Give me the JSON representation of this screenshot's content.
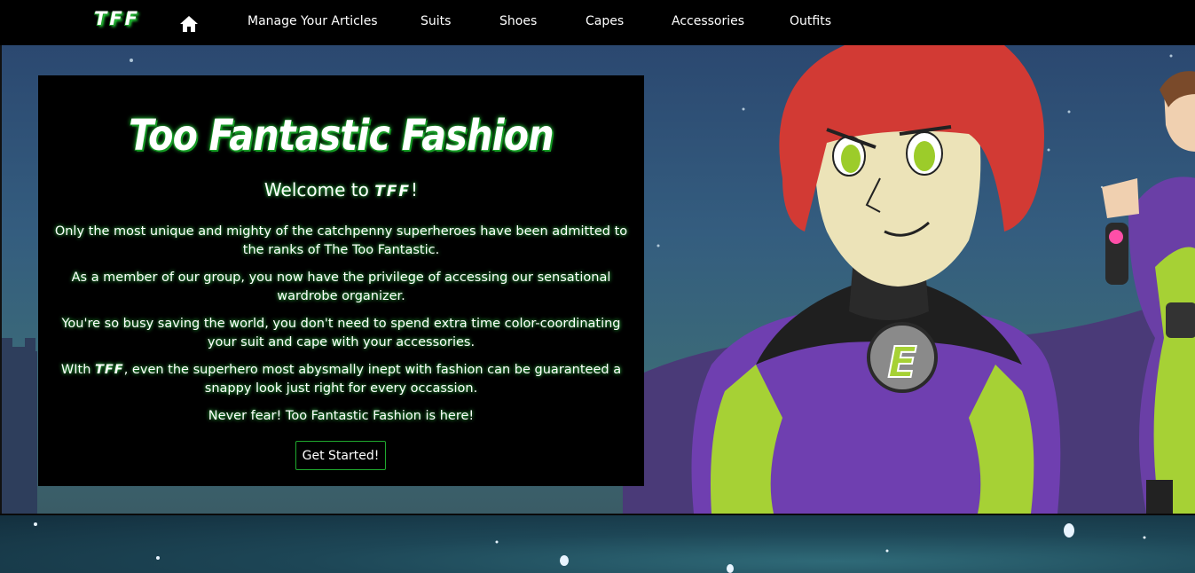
{
  "nav": {
    "brand": "TFF",
    "home_icon": "home-icon",
    "items": [
      {
        "label": "Manage Your Articles"
      },
      {
        "label": "Suits"
      },
      {
        "label": "Shoes"
      },
      {
        "label": "Capes"
      },
      {
        "label": "Accessories"
      },
      {
        "label": "Outfits"
      }
    ]
  },
  "hero": {
    "title": "Too Fantastic Fashion",
    "welcome_prefix": "Welcome to ",
    "welcome_brand": "TFF",
    "welcome_suffix": "!",
    "paragraphs": [
      "Only the most unique and mighty of the catchpenny superheroes have been admitted to the ranks of The Too Fantastic.",
      "As a member of our group, you now have the privilege of accessing our sensational wardrobe organizer.",
      "You're so busy saving the world, you don't need to spend extra time color-coordinating your suit and cape with your accessories."
    ],
    "p4_prefix": "WIth ",
    "p4_brand": "TFF",
    "p4_suffix": ", even the superhero most abysmally inept with fashion can be guaranteed a snappy look just right for every occassion.",
    "tagline": "Never fear! Too Fantastic Fashion is here!",
    "cta_label": "Get Started!"
  },
  "colors": {
    "accent_green": "#2aff45",
    "navbar_bg": "#000000",
    "panel_bg": "#000000"
  }
}
